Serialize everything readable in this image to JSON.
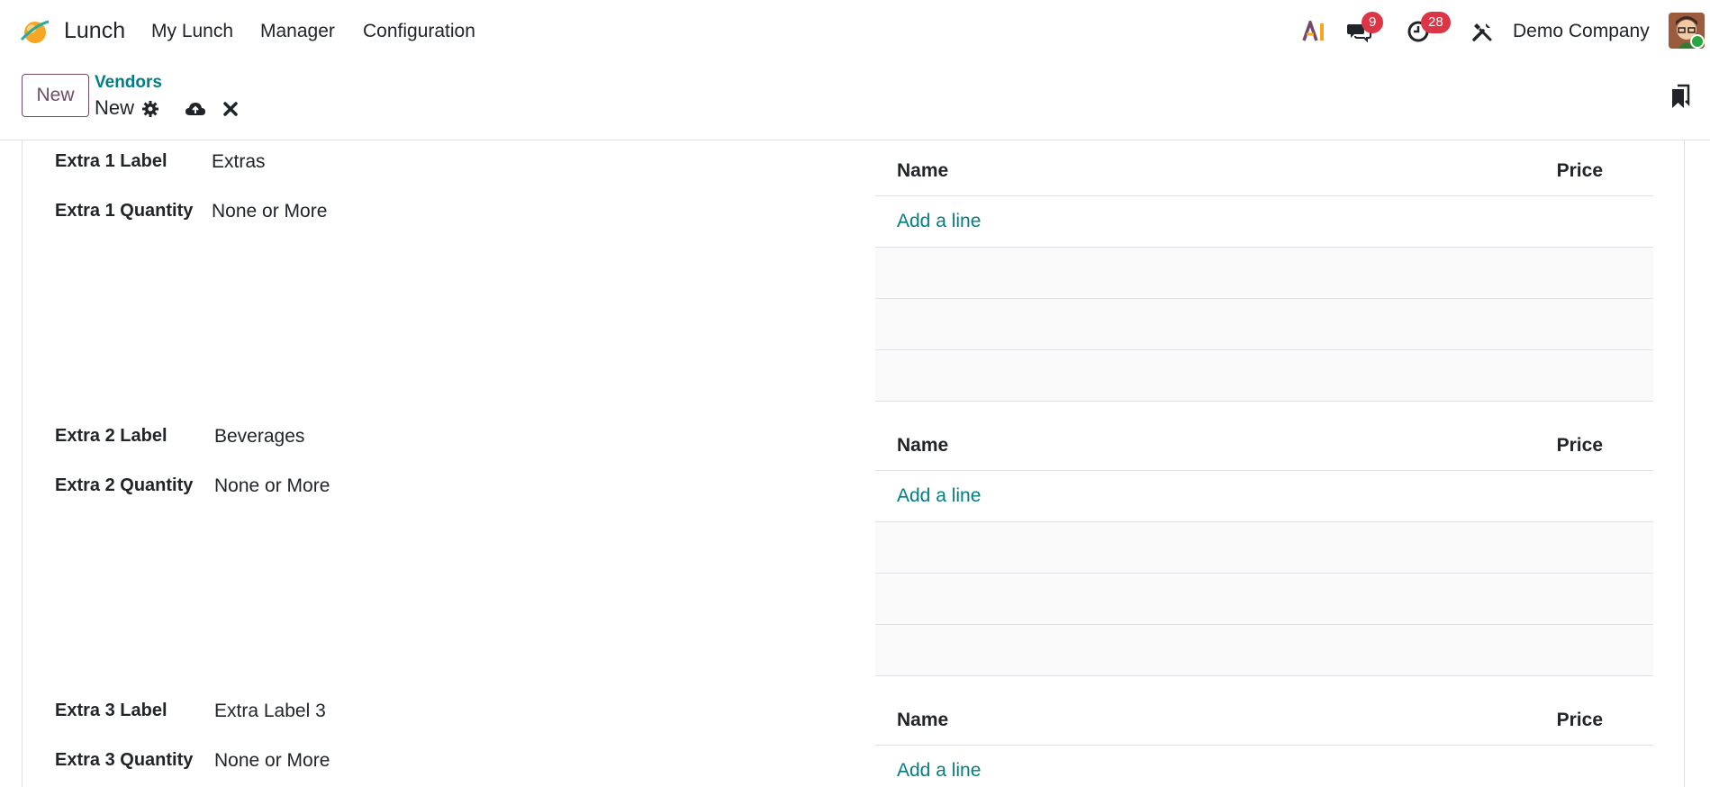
{
  "navbar": {
    "app_name": "Lunch",
    "menu": [
      "My Lunch",
      "Manager",
      "Configuration"
    ],
    "ai_label": "AI",
    "messages_count": "9",
    "activities_count": "28",
    "company": "Demo Company"
  },
  "control": {
    "new_label": "New",
    "breadcrumb": "Vendors",
    "record_name": "New"
  },
  "sections": [
    {
      "label_title": "Extra 1 Label",
      "label_value": "Extras",
      "qty_title": "Extra 1 Quantity",
      "qty_value": "None or More",
      "table": {
        "col_name": "Name",
        "col_price": "Price",
        "add_line": "Add a line"
      }
    },
    {
      "label_title": "Extra 2 Label",
      "label_value": "Beverages",
      "qty_title": "Extra 2 Quantity",
      "qty_value": "None or More",
      "table": {
        "col_name": "Name",
        "col_price": "Price",
        "add_line": "Add a line"
      }
    },
    {
      "label_title": "Extra 3 Label",
      "label_value": "Extra Label 3",
      "qty_title": "Extra 3 Quantity",
      "qty_value": "None or More",
      "table": {
        "col_name": "Name",
        "col_price": "Price",
        "add_line": "Add a line"
      }
    }
  ],
  "colors": {
    "brand": "#714b67",
    "link": "#017e84",
    "badge": "#dc3545"
  },
  "icons": [
    "app-logo-icon",
    "ai-icon",
    "chat-icon",
    "clock-icon",
    "tools-icon",
    "gear-icon",
    "cloud-upload-icon",
    "close-icon",
    "bookmark-icon"
  ]
}
